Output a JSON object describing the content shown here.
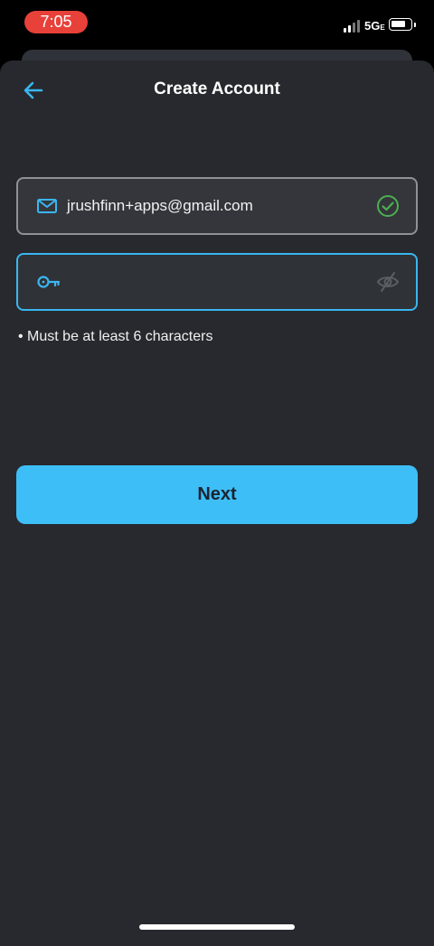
{
  "status_bar": {
    "time": "7:05",
    "network": "5G",
    "network_suffix": "E"
  },
  "header": {
    "title": "Create Account"
  },
  "email_field": {
    "value": "jrushfinn+apps@gmail.com"
  },
  "password_field": {
    "value": ""
  },
  "hint": "• Must be at least 6 characters",
  "next_label": "Next",
  "colors": {
    "accent": "#3ebef6",
    "success": "#4caf50",
    "background": "#27292e"
  }
}
